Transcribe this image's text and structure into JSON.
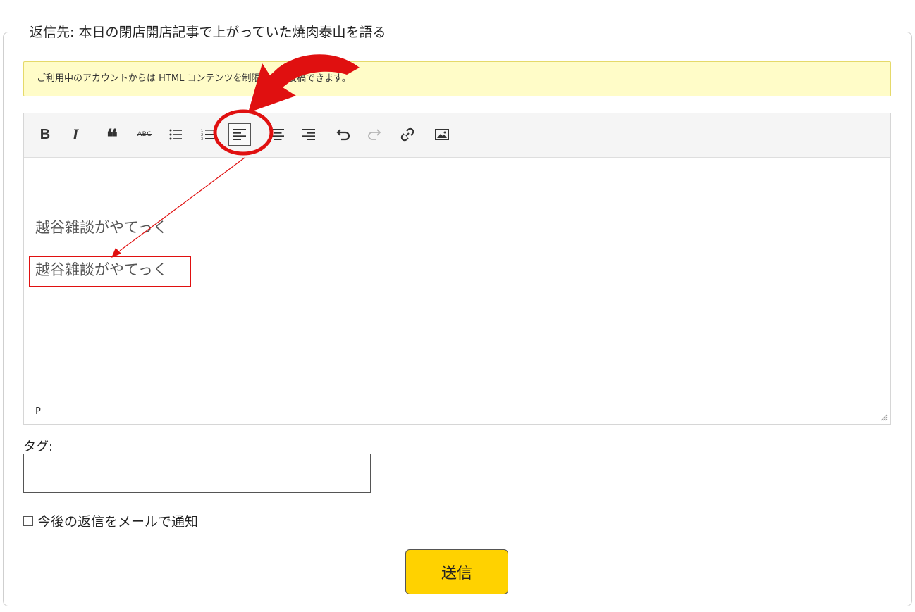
{
  "reply": {
    "legend": "返信先: 本日の閉店開店記事で上がっていた焼肉泰山を語る",
    "notice": "ご利用中のアカウントからは HTML コンテンツを制限無しで投稿できます。"
  },
  "toolbar": {
    "buttons": [
      {
        "name": "bold",
        "label": "B",
        "icon": "bold-icon"
      },
      {
        "name": "italic",
        "label": "I",
        "icon": "italic-icon"
      },
      {
        "name": "blockquote",
        "label": "66",
        "icon": "blockquote-icon"
      },
      {
        "name": "strikethrough",
        "label": "ABC",
        "icon": "strikethrough-icon"
      },
      {
        "name": "bullet-list",
        "icon": "bullet-list-icon"
      },
      {
        "name": "numbered-list",
        "icon": "numbered-list-icon"
      },
      {
        "name": "align-left",
        "icon": "align-left-icon",
        "active": true
      },
      {
        "name": "align-center",
        "icon": "align-center-icon"
      },
      {
        "name": "align-right",
        "icon": "align-right-icon"
      },
      {
        "name": "undo",
        "icon": "undo-icon"
      },
      {
        "name": "redo",
        "icon": "redo-icon",
        "disabled": true
      },
      {
        "name": "link",
        "icon": "link-icon"
      },
      {
        "name": "image",
        "icon": "image-icon"
      }
    ]
  },
  "editor": {
    "paragraphs": [
      "越谷雑談がやてっく",
      "越谷雑談がやてっく"
    ],
    "status_path": "P"
  },
  "tags": {
    "label": "タグ:",
    "value": ""
  },
  "notify": {
    "label": "今後の返信をメールで通知",
    "checked": false
  },
  "submit": {
    "label": "送信"
  },
  "annotation": {
    "highlight_color": "#e01010"
  }
}
